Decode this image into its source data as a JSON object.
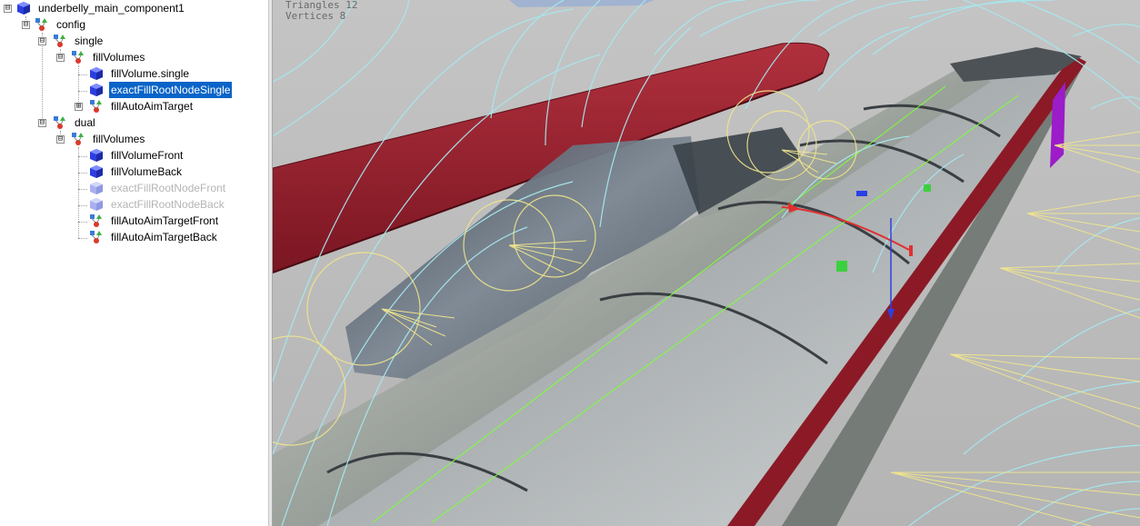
{
  "tree": {
    "root": {
      "label": "underbelly_main_component1"
    },
    "config": {
      "label": "config"
    },
    "single": {
      "label": "single"
    },
    "single_fillVolumes": {
      "label": "fillVolumes"
    },
    "fillVolume_single": {
      "label": "fillVolume.single"
    },
    "exactFillRootNodeSingle": {
      "label": "exactFillRootNodeSingle"
    },
    "fillAutoAimTarget": {
      "label": "fillAutoAimTarget"
    },
    "dual": {
      "label": "dual"
    },
    "dual_fillVolumes": {
      "label": "fillVolumes"
    },
    "fillVolumeFront": {
      "label": "fillVolumeFront"
    },
    "fillVolumeBack": {
      "label": "fillVolumeBack"
    },
    "exactFillRootNodeFront": {
      "label": "exactFillRootNodeFront"
    },
    "exactFillRootNodeBack": {
      "label": "exactFillRootNodeBack"
    },
    "fillAutoAimTargetFront": {
      "label": "fillAutoAimTargetFront"
    },
    "fillAutoAimTargetBack": {
      "label": "fillAutoAimTargetBack"
    },
    "expander_open": "⊟",
    "expander_closed": "⊞"
  },
  "viewport": {
    "triangles": "Triangles 12",
    "vertices": "Vertices 8"
  },
  "colors": {
    "selection": "#0a64c8",
    "body_red": "#8b1a26",
    "gizmo_line": "#a6e8f0",
    "aim_line": "#f0e68c",
    "green_line": "#7dff3a"
  }
}
